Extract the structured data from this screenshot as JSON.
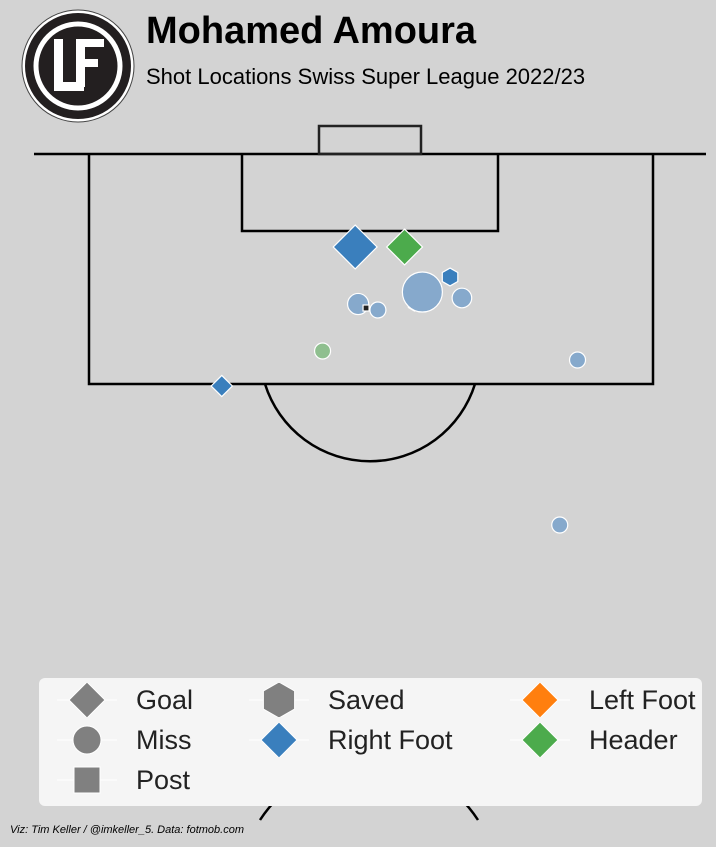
{
  "header": {
    "title": "Mohamed Amoura",
    "subtitle": "Shot Locations Swiss Super League 2022/23"
  },
  "credit": "Viz: Tim Keller / @imkeller_5. Data: fotmob.com",
  "logo": {
    "icon": "club-crest-icon"
  },
  "colors": {
    "background": "#d3d3d3",
    "right_foot": "#3a7fbd",
    "header": "#4cab4c",
    "left_foot": "#ff7f0e",
    "miss": "#86a9cc",
    "legend_neutral": "#808080",
    "lines": "#000000"
  },
  "legend": {
    "items": [
      {
        "label": "Goal",
        "symbol": "diamond",
        "color": "#808080"
      },
      {
        "label": "Miss",
        "symbol": "circle",
        "color": "#808080"
      },
      {
        "label": "Post",
        "symbol": "square",
        "color": "#808080"
      },
      {
        "label": "Saved",
        "symbol": "hexagon",
        "color": "#808080"
      },
      {
        "label": "Right Foot",
        "symbol": "diamond",
        "color": "#3a7fbd"
      },
      {
        "label": "Left Foot",
        "symbol": "diamond",
        "color": "#ff7f0e"
      },
      {
        "label": "Header",
        "symbol": "diamond",
        "color": "#4cab4c"
      }
    ]
  },
  "chart_data": {
    "type": "scatter",
    "title": "Mohamed Amoura",
    "subtitle": "Shot Locations Swiss Super League 2022/23",
    "x_unit": "meters across pitch (0 = left touchline, 68 = right touchline)",
    "y_unit": "meters from goal line",
    "xlim": [
      0,
      68
    ],
    "ylim": [
      0,
      52.5
    ],
    "points": [
      {
        "x": 32.5,
        "y": 9.3,
        "result": "Goal",
        "body_part": "Right Foot",
        "xg": 0.3
      },
      {
        "x": 37.5,
        "y": 9.3,
        "result": "Goal",
        "body_part": "Header",
        "xg": 0.2
      },
      {
        "x": 42.1,
        "y": 12.3,
        "result": "Saved",
        "body_part": "Right Foot",
        "xg": 0.05
      },
      {
        "x": 38.5,
        "y": 15.0,
        "result": "Saved",
        "body_part": "Header",
        "xg": 0.03
      },
      {
        "x": 19.0,
        "y": 23.2,
        "result": "Goal",
        "body_part": "Right Foot",
        "xg": 0.07
      },
      {
        "x": 39.3,
        "y": 13.8,
        "result": "Miss",
        "body_part": "Right Foot",
        "xg": 0.25
      },
      {
        "x": 32.8,
        "y": 15.0,
        "result": "Miss",
        "body_part": "Right Foot",
        "xg": 0.07
      },
      {
        "x": 34.8,
        "y": 15.6,
        "result": "Miss",
        "body_part": "Right Foot",
        "xg": 0.04
      },
      {
        "x": 43.3,
        "y": 14.4,
        "result": "Miss",
        "body_part": "Right Foot",
        "xg": 0.06
      },
      {
        "x": 29.2,
        "y": 19.7,
        "result": "Miss",
        "body_part": "Header",
        "xg": 0.04
      },
      {
        "x": 55.0,
        "y": 20.6,
        "result": "Miss",
        "body_part": "Right Foot",
        "xg": 0.04
      },
      {
        "x": 53.2,
        "y": 37.1,
        "result": "Miss",
        "body_part": "Right Foot",
        "xg": 0.04
      },
      {
        "x": 33.6,
        "y": 15.4,
        "result": "Post",
        "body_part": "Right Foot",
        "xg": 0.01
      }
    ],
    "legend_entries": [
      "Goal",
      "Miss",
      "Post",
      "Saved",
      "Right Foot",
      "Left Foot",
      "Header"
    ]
  }
}
